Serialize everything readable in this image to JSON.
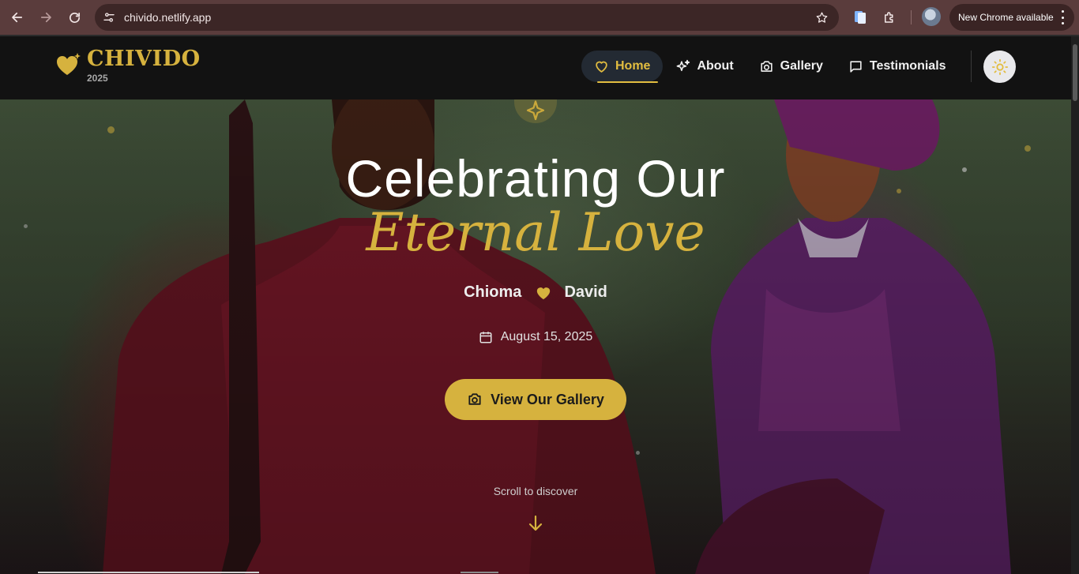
{
  "browser": {
    "url": "chivido.netlify.app",
    "update_label": "New Chrome available"
  },
  "site": {
    "brand_name": "CHIVIDO",
    "brand_year": "2025",
    "nav": [
      {
        "label": "Home",
        "icon": "heart-icon",
        "active": true
      },
      {
        "label": "About",
        "icon": "sparkles-icon",
        "active": false
      },
      {
        "label": "Gallery",
        "icon": "camera-icon",
        "active": false
      },
      {
        "label": "Testimonials",
        "icon": "message-icon",
        "active": false
      }
    ],
    "theme_icon": "sun-icon"
  },
  "hero": {
    "headline_line1": "Celebrating Our",
    "headline_line2": "Eternal Love",
    "partner_1": "Chioma",
    "partner_2": "David",
    "date": "August 15, 2025",
    "cta_label": "View Our Gallery",
    "scroll_hint": "Scroll to discover"
  },
  "colors": {
    "accent_gold": "#d6b23e",
    "header_bg": "#121212",
    "browser_bar": "#5a3c3c"
  }
}
